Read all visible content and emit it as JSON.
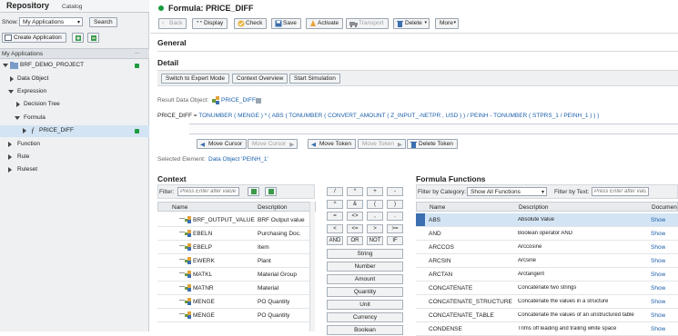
{
  "left_panel": {
    "title": "Repository",
    "tab_catalog": "Catalog",
    "show_label": "Show:",
    "show_value": "My Applications",
    "search_button": "Search",
    "create_button": "Create Application",
    "tree_header": "My Applications",
    "tree": [
      {
        "label": "BRF_DEMO_PROJECT"
      },
      {
        "label": "Data Object"
      },
      {
        "label": "Expression"
      },
      {
        "label": "Decision Tree"
      },
      {
        "label": "Formula"
      },
      {
        "label": "PRICE_DIFF"
      },
      {
        "label": "Function"
      },
      {
        "label": "Rule"
      },
      {
        "label": "Ruleset"
      }
    ]
  },
  "header": {
    "title": "Formula: PRICE_DIFF"
  },
  "toolbar": {
    "back": "Back",
    "display": "Display",
    "check": "Check",
    "save": "Save",
    "activate": "Activate",
    "transport": "Transport",
    "delete": "Delete",
    "more": "More"
  },
  "general_title": "General",
  "detail_title": "Detail",
  "detail_buttons": {
    "expert": "Switch to Expert Mode",
    "overview": "Context Overview",
    "simulation": "Start Simulation"
  },
  "result_label": "Result Data Object:",
  "result_value": "PRICE_DIFF",
  "formula": {
    "name": "PRICE_DIFF",
    "expr": "TONUMBER  (  MENGE  )  *  (  ABS  (  TONUMBER  (  CONVERT_AMOUNT  (  Z_INPUT_-NETPR  ,  USD  )  )  /  PEINH  -  TONUMBER  (  STPRS_1  /  PEINH_1  )  )  )"
  },
  "cursor_buttons": {
    "move_cursor_left": "Move Cursor",
    "move_cursor_right": "Move Cursor",
    "move_token_left": "Move Token",
    "move_token_right": "Move Token",
    "delete_token": "Delete Token"
  },
  "selected_label": "Selected Element:",
  "selected_value": "Data Object 'PEINH_1'",
  "context": {
    "title": "Context",
    "filter_label": "Filter:",
    "filter_placeholder": "Press Enter after value",
    "col_name": "Name",
    "col_desc": "Description",
    "rows": [
      {
        "name": "BRF_OUTPUT_VALUE",
        "desc": "BRF Output value"
      },
      {
        "name": "EBELN",
        "desc": "Purchasing Doc."
      },
      {
        "name": "EBELP",
        "desc": "Item"
      },
      {
        "name": "EWERK",
        "desc": "Plant"
      },
      {
        "name": "MATKL",
        "desc": "Material Group"
      },
      {
        "name": "MATNR",
        "desc": "Material"
      },
      {
        "name": "MENGE",
        "desc": "PO Quantity"
      },
      {
        "name": "MENGE",
        "desc": "PO Quantity"
      }
    ]
  },
  "keypad": {
    "keys": [
      "/",
      "*",
      "+",
      "-",
      "^",
      "&",
      "(",
      ")",
      "=",
      "<>",
      ",",
      ".",
      "<",
      "<=",
      ">",
      ">=",
      "AND",
      "OR",
      "NOT",
      "IF"
    ],
    "types": [
      "String",
      "Number",
      "Amount",
      "Quantity",
      "Unit",
      "Currency",
      "Boolean"
    ]
  },
  "functions": {
    "title": "Formula Functions",
    "category_label": "Filter by Category:",
    "category_value": "Show All Functions",
    "text_label": "Filter by Text:",
    "text_placeholder": "Press Enter after valu",
    "col_name": "Name",
    "col_desc": "Description",
    "col_doc": "Documen",
    "show": "Show",
    "rows": [
      {
        "name": "ABS",
        "desc": "Absolute Value"
      },
      {
        "name": "AND",
        "desc": "Boolean operator AND"
      },
      {
        "name": "ARCCOS",
        "desc": "Arccosine"
      },
      {
        "name": "ARCSIN",
        "desc": "Arcsine"
      },
      {
        "name": "ARCTAN",
        "desc": "Arctangent"
      },
      {
        "name": "CONCATENATE",
        "desc": "Concatenate two strings"
      },
      {
        "name": "CONCATENATE_STRUCTURE",
        "desc": "Concatenate the values in a structure"
      },
      {
        "name": "CONCATENATE_TABLE",
        "desc": "Concatenate the values of an unstructured table"
      },
      {
        "name": "CONDENSE",
        "desc": "Trims off leading and trailing white space"
      }
    ]
  },
  "colors": {
    "accent": "#1b5fa8",
    "status_green": "#1a9c3e",
    "selected_row": "#d3e4f4"
  }
}
